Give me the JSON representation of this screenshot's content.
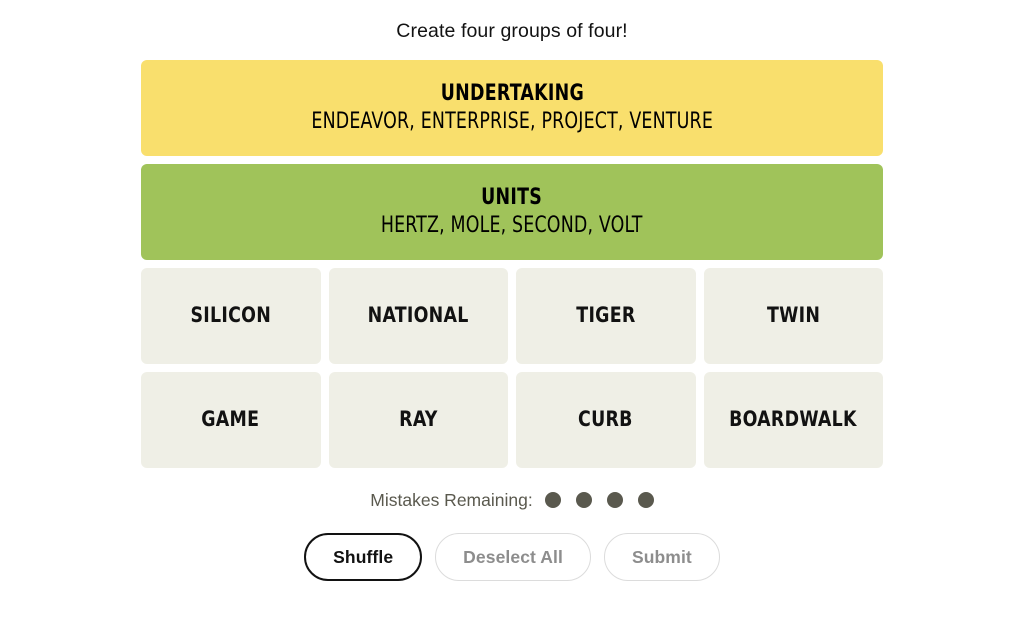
{
  "game": {
    "title": "Create four groups of four!"
  },
  "solved_groups": [
    {
      "category": "UNDERTAKING",
      "members": "ENDEAVOR, ENTERPRISE, PROJECT, VENTURE",
      "color": "#f9df6d",
      "difficulty": "yellow"
    },
    {
      "category": "UNITS",
      "members": "HERTZ, MOLE, SECOND, VOLT",
      "color": "#a0c35a",
      "difficulty": "green"
    }
  ],
  "tile_rows": [
    [
      "SILICON",
      "NATIONAL",
      "TIGER",
      "TWIN"
    ],
    [
      "GAME",
      "RAY",
      "CURB",
      "BOARDWALK"
    ]
  ],
  "mistakes": {
    "label": "Mistakes Remaining:",
    "remaining": 4,
    "dot_color": "#5a594e"
  },
  "buttons": {
    "shuffle": "Shuffle",
    "deselect_all": "Deselect All",
    "submit": "Submit"
  },
  "colors": {
    "tile_background": "#efefe6",
    "text": "#121212",
    "muted_text": "#5a594e",
    "disabled_text": "#8d8d8d",
    "disabled_border": "#dcdcdc"
  }
}
